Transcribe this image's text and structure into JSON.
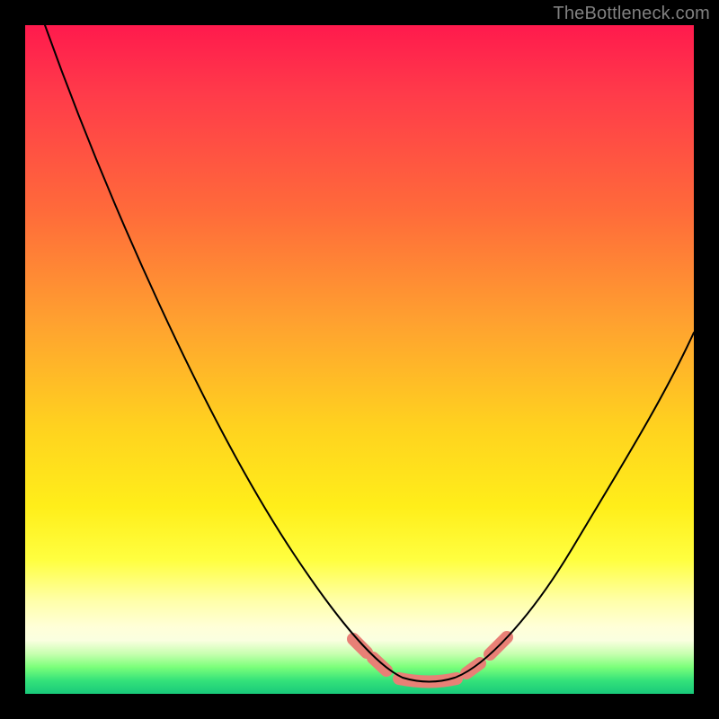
{
  "watermark": "TheBottleneck.com",
  "chart_data": {
    "type": "line",
    "title": "",
    "xlabel": "",
    "ylabel": "",
    "xlim": [
      0,
      100
    ],
    "ylim": [
      0,
      100
    ],
    "grid": false,
    "legend": false,
    "series": [
      {
        "name": "bottleneck-curve",
        "x": [
          3,
          10,
          20,
          30,
          40,
          47,
          52,
          58,
          62,
          66,
          72,
          80,
          90,
          100
        ],
        "y": [
          100,
          80,
          56,
          35,
          18,
          8,
          3,
          1,
          1,
          2,
          6,
          18,
          36,
          54
        ],
        "color": "#000000"
      }
    ],
    "markers": [
      {
        "name": "marker-left-upper",
        "x_range": [
          49,
          51
        ],
        "color": "#e88076"
      },
      {
        "name": "marker-left-lower",
        "x_range": [
          52,
          54
        ],
        "color": "#e88076"
      },
      {
        "name": "marker-flat",
        "x_range": [
          56,
          64
        ],
        "color": "#e88076"
      },
      {
        "name": "marker-right-lower",
        "x_range": [
          66,
          68
        ],
        "color": "#e88076"
      },
      {
        "name": "marker-right-upper",
        "x_range": [
          69.5,
          72
        ],
        "color": "#e88076"
      }
    ],
    "background_gradient": {
      "top": "#ff1a4d",
      "mid": "#ffee1a",
      "bottom": "#18c97a"
    }
  }
}
